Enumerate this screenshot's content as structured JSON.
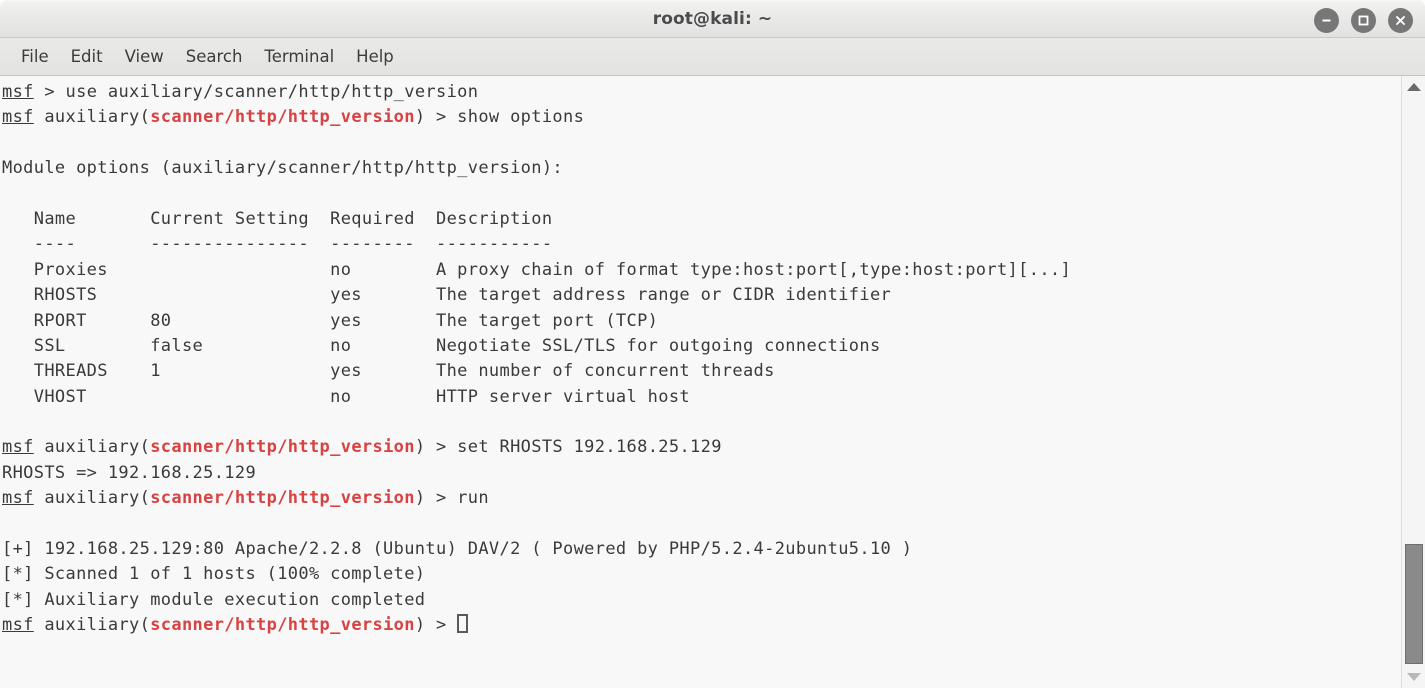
{
  "window": {
    "title": "root@kali: ~",
    "controls": [
      {
        "name": "minimize-button",
        "glyph": "minimize"
      },
      {
        "name": "maximize-button",
        "glyph": "maximize"
      },
      {
        "name": "close-button",
        "glyph": "close"
      }
    ]
  },
  "menubar": {
    "items": [
      "File",
      "Edit",
      "View",
      "Search",
      "Terminal",
      "Help"
    ]
  },
  "colors": {
    "prompt_module": "#d84242",
    "text": "#3a3a3a",
    "terminal_background": "#f8f8f8",
    "titlebar_background": "#e8e8e7",
    "window_button": "#777777"
  },
  "terminal": {
    "prompt_name": "msf",
    "module_path": "scanner/http/http_version",
    "lines": {
      "l1_cmd": " > use auxiliary/scanner/http/http_version",
      "l2_pre": " auxiliary(",
      "l2_post": ") > show options",
      "l3_blank": "",
      "l4_header": "Module options (auxiliary/scanner/http/http_version):",
      "l5_blank": "",
      "table_header": "   Name       Current Setting  Required  Description",
      "table_rule": "   ----       ---------------  --------  -----------",
      "row_proxies": "   Proxies                     no        A proxy chain of format type:host:port[,type:host:port][...]",
      "row_rhosts": "   RHOSTS                      yes       The target address range or CIDR identifier",
      "row_rport": "   RPORT      80               yes       The target port (TCP)",
      "row_ssl": "   SSL        false            no        Negotiate SSL/TLS for outgoing connections",
      "row_threads": "   THREADS    1                yes       The number of concurrent threads",
      "row_vhost": "   VHOST                       no        HTTP server virtual host",
      "l13_blank": "",
      "l14_post": ") > set RHOSTS 192.168.25.129",
      "l15_echo": "RHOSTS => 192.168.25.129",
      "l16_post": ") > run",
      "l17_blank": "",
      "l18_result": "[+] 192.168.25.129:80 Apache/2.2.8 (Ubuntu) DAV/2 ( Powered by PHP/5.2.4-2ubuntu5.10 )",
      "l19_scanned": "[*] Scanned 1 of 1 hosts (100% complete)",
      "l20_completed": "[*] Auxiliary module execution completed",
      "l21_post": ") > "
    },
    "table": {
      "columns": [
        "Name",
        "Current Setting",
        "Required",
        "Description"
      ],
      "rows": [
        {
          "name": "Proxies",
          "current_setting": "",
          "required": "no",
          "description": "A proxy chain of format type:host:port[,type:host:port][...]"
        },
        {
          "name": "RHOSTS",
          "current_setting": "",
          "required": "yes",
          "description": "The target address range or CIDR identifier"
        },
        {
          "name": "RPORT",
          "current_setting": "80",
          "required": "yes",
          "description": "The target port (TCP)"
        },
        {
          "name": "SSL",
          "current_setting": "false",
          "required": "no",
          "description": "Negotiate SSL/TLS for outgoing connections"
        },
        {
          "name": "THREADS",
          "current_setting": "1",
          "required": "yes",
          "description": "The number of concurrent threads"
        },
        {
          "name": "VHOST",
          "current_setting": "",
          "required": "no",
          "description": "HTTP server virtual host"
        }
      ]
    }
  },
  "scrollbar": {
    "up_arrow": "scroll-up-arrow",
    "down_arrow": "scroll-down-arrow",
    "thumb": "scroll-thumb"
  }
}
